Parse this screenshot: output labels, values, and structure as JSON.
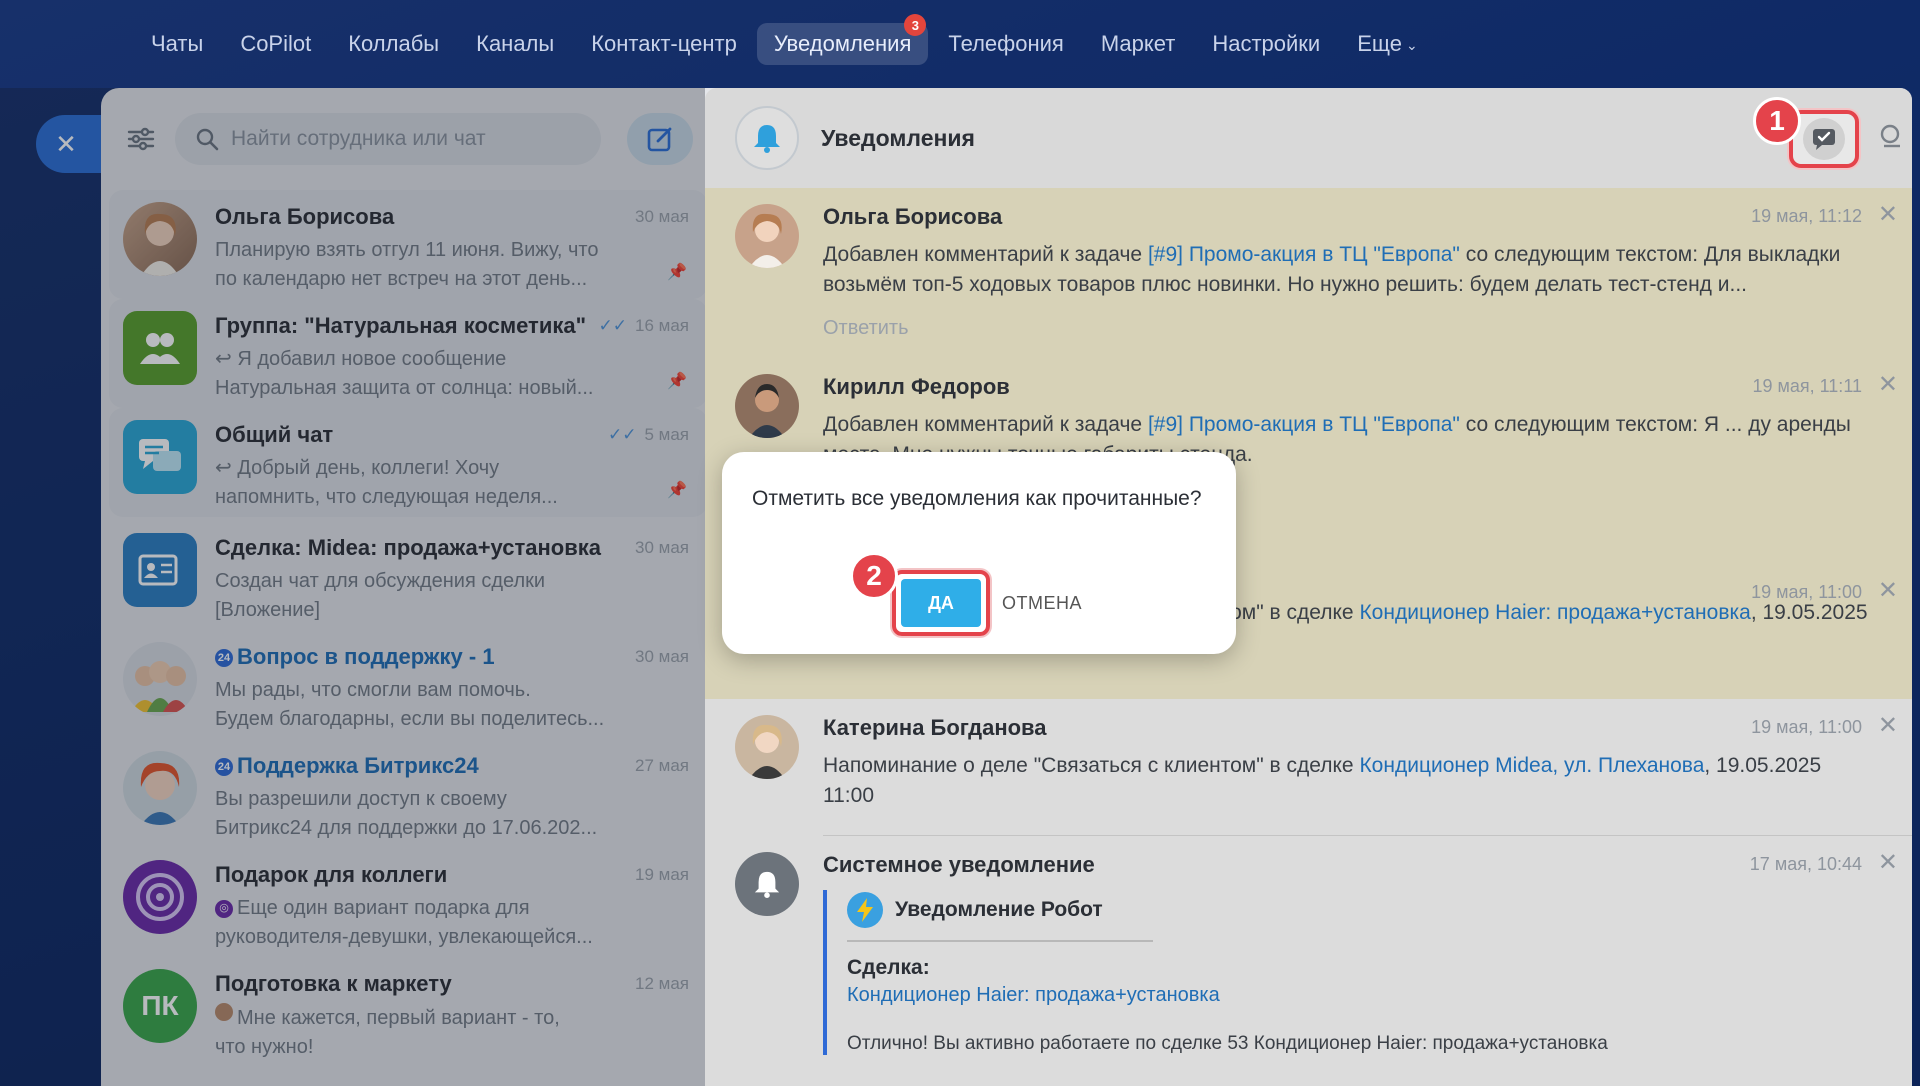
{
  "nav": {
    "items": [
      {
        "label": "Чаты"
      },
      {
        "label": "CoPilot"
      },
      {
        "label": "Коллабы"
      },
      {
        "label": "Каналы"
      },
      {
        "label": "Контакт-центр"
      },
      {
        "label": "Уведомления",
        "badge": "3",
        "active": true
      },
      {
        "label": "Телефония"
      },
      {
        "label": "Маркет"
      },
      {
        "label": "Настройки"
      },
      {
        "label": "Еще"
      }
    ]
  },
  "search": {
    "placeholder": "Найти сотрудника или чат"
  },
  "chats": [
    {
      "name": "Ольга Борисова",
      "date": "30 мая",
      "msg1": "Планирую взять отгул 11 июня. Вижу, что",
      "msg2": "по календарю нет встреч на этот день...",
      "pinned": true
    },
    {
      "name": "Группа: \"Натуральная косметика\"",
      "date": "16 мая",
      "msg1": "↩ Я добавил новое сообщение",
      "msg2": "Натуральная защита от солнца: новый...",
      "pinned": true
    },
    {
      "name": "Общий чат",
      "date": "5 мая",
      "msg1": "↩ Добрый день, коллеги! Хочу",
      "msg2": "напомнить, что следующая неделя...",
      "pinned": true
    },
    {
      "name": "Сделка: Midea: продажа+установка",
      "date": "30 мая",
      "msg1": "Создан чат для обсуждения сделки",
      "msg2": "[Вложение]"
    },
    {
      "name": "Вопрос в поддержку - 1",
      "date": "30 мая",
      "msg1": "Мы рады, что смогли вам помочь.",
      "msg2": "Будем благодарны, если вы поделитесь..."
    },
    {
      "name": "Поддержка Битрикс24",
      "date": "27 мая",
      "msg1": "Вы разрешили доступ к своему",
      "msg2": "Битрикс24 для поддержки до 17.06.202..."
    },
    {
      "name": "Подарок для коллеги",
      "date": "19 мая",
      "msg1": "Еще один вариант подарка для",
      "msg2": "руководителя-девушки, увлекающейся..."
    },
    {
      "name": "Подготовка к маркету",
      "date": "12 мая",
      "avatar_text": "ПК",
      "msg1": "Мне кажется, первый вариант - то,",
      "msg2": "что нужно!"
    }
  ],
  "notifications": {
    "title": "Уведомления",
    "items": [
      {
        "author": "Ольга Борисова",
        "time": "19 мая, 11:12",
        "pre": "Добавлен комментарий к задаче ",
        "link": "[#9] Промо-акция в ТЦ \"Европа\"",
        "post": " со следующим текстом: Для выкладки возьмём топ-5 ходовых товаров плюс новинки. Но нужно решить: будем делать тест-стенд и...",
        "reply": "Ответить"
      },
      {
        "author": "Кирилл Федоров",
        "time": "19 мая, 11:11",
        "pre": "Добавлен комментарий к задаче ",
        "link": "[#9] Промо-акция в ТЦ \"Европа\"",
        "post": " со следующим текстом: Я ... ду аренды места. Мне нужны точные габариты стенда."
      },
      {
        "author": "",
        "time": "19 мая, 11:00",
        "pre": "Напоминание о деле \"Связаться с клиентом\" в сделке ",
        "link": "Кондиционер Haier: продажа+установка",
        "post": ", 19.05.2025 11:00"
      },
      {
        "author": "Катерина Богданова",
        "time": "19 мая, 11:00",
        "pre": "Напоминание о деле \"Связаться с клиентом\" в сделке ",
        "link": "Кондиционер Midea, ул. Плеханова",
        "post": ", 19.05.2025 11:00"
      },
      {
        "author": "Системное уведомление",
        "time": "17 мая, 10:44",
        "robot": "Уведомление Робот",
        "deal_label": "Сделка:",
        "deal_link": "Кондиционер Haier: продажа+установка",
        "desc": "Отлично! Вы активно работаете по сделке 53 Кондиционер Haier: продажа+установка"
      }
    ]
  },
  "dialog": {
    "question": "Отметить все уведомления как прочитанные?",
    "yes": "ДА",
    "cancel": "ОТМЕНА"
  },
  "steps": {
    "one": "1",
    "two": "2"
  },
  "colors": {
    "accent": "#2f6ad6",
    "highlight": "#e4434b",
    "unread_bg": "#d7d2b7"
  }
}
